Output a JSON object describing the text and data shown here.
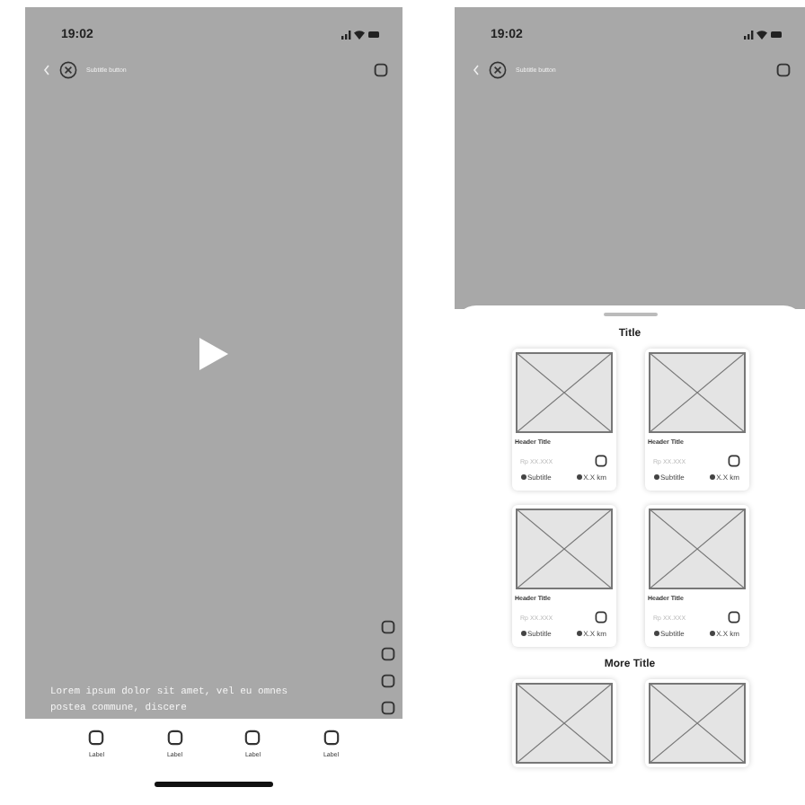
{
  "player": {
    "status_time": "19:02",
    "subtitle": "Subtitle button",
    "caption": "Lorem ipsum dolor sit amet, vel eu omnes postea commune, discere",
    "nav": [
      {
        "label": "Label"
      },
      {
        "label": "Label"
      },
      {
        "label": "Label"
      },
      {
        "label": "Label"
      }
    ]
  },
  "sheet_screen": {
    "status_time": "19:02",
    "subtitle": "Subtitle button",
    "sections": [
      {
        "title": "Title",
        "cards": [
          {
            "kind": "full",
            "title": "Header Title",
            "price": "Rp XX.XXX",
            "subtitle": "Subtitle",
            "distance": "X.X km"
          },
          {
            "kind": "full",
            "title": "Header Title",
            "price": "Rp XX.XXX",
            "subtitle": "Subtitle",
            "distance": "X.X km"
          },
          {
            "kind": "full",
            "title": "Header Title",
            "price": "Rp XX.XXX",
            "subtitle": "Subtitle",
            "distance": "X.X km"
          },
          {
            "kind": "full",
            "title": "Header Title",
            "price": "Rp XX.XXX",
            "subtitle": "Subtitle",
            "distance": "X.X km"
          }
        ]
      },
      {
        "title": "More Title",
        "cards": [
          {
            "kind": "cut"
          },
          {
            "kind": "cut"
          }
        ]
      }
    ]
  }
}
